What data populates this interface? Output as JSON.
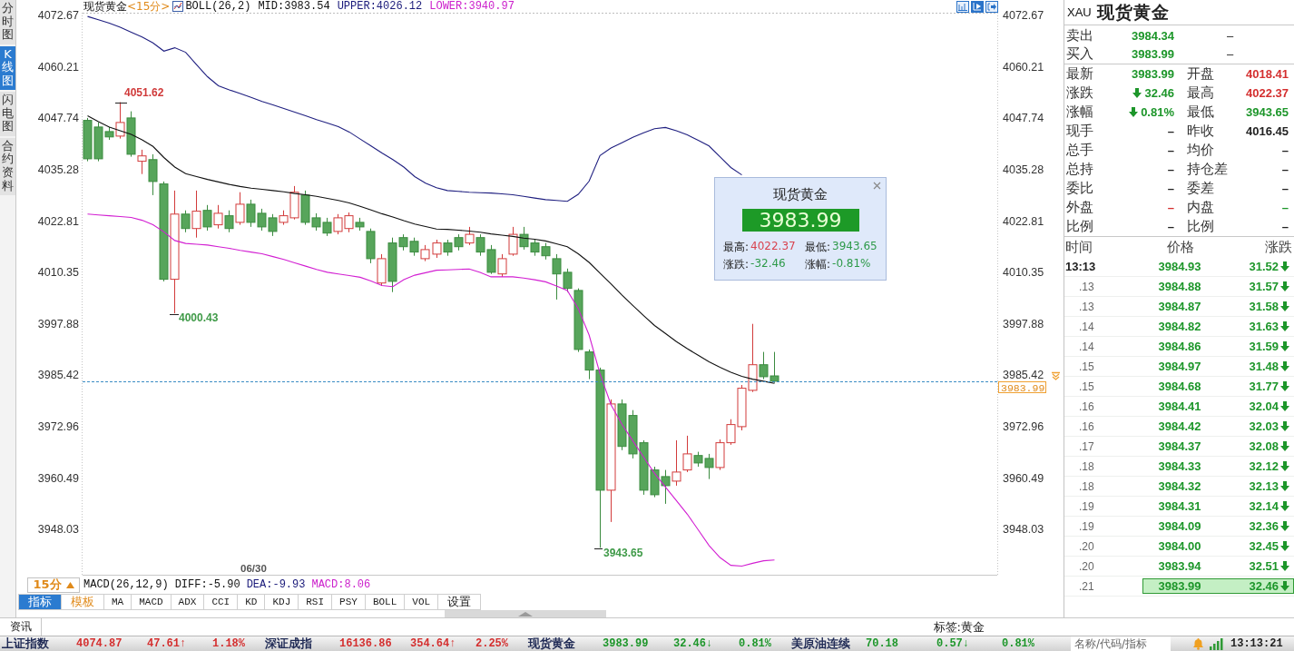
{
  "side_tabs": [
    {
      "label": "分时图",
      "selected": false
    },
    {
      "label": "K线图",
      "selected": true
    },
    {
      "label": "闪电图",
      "selected": false
    },
    {
      "label": "合约资料",
      "selected": false
    }
  ],
  "chart": {
    "symbol": "现货黄金",
    "period": "<15分>",
    "indicator": "BOLL(26,2)",
    "readouts": [
      {
        "kind": "mid",
        "text": "MID:3983.54"
      },
      {
        "kind": "upper",
        "text": "UPPER:4026.12"
      },
      {
        "kind": "lower",
        "text": "LOWER:3940.97"
      }
    ],
    "chart_data": {
      "type": "candlestick",
      "categories": [
        null,
        null,
        null,
        null,
        null,
        null,
        null,
        null,
        null,
        null,
        null,
        null,
        null,
        null,
        null,
        null,
        null,
        null,
        null,
        null,
        null,
        null,
        null,
        null,
        null,
        null,
        null,
        null,
        null,
        null,
        null,
        null,
        null,
        null,
        null,
        null,
        null,
        null,
        null,
        null,
        null,
        null,
        null,
        null,
        null,
        null,
        null,
        null,
        null,
        null,
        null,
        null,
        null,
        null,
        null,
        null,
        null,
        null,
        null,
        null,
        null,
        null,
        null,
        null
      ],
      "ylim": [
        3936.9,
        4073.3
      ],
      "yticks": [
        {
          "value": 4072.67,
          "label": "4072.67"
        },
        {
          "value": 4060.21,
          "label": "4060.21"
        },
        {
          "value": 4047.74,
          "label": "4047.74"
        },
        {
          "value": 4035.28,
          "label": "4035.28"
        },
        {
          "value": 4022.81,
          "label": "4022.81"
        },
        {
          "value": 4010.35,
          "label": "4010.35"
        },
        {
          "value": 3997.88,
          "label": "3997.88"
        },
        {
          "value": 3985.42,
          "label": "3985.42"
        },
        {
          "value": 3972.96,
          "label": "3972.96"
        },
        {
          "value": 3960.49,
          "label": "3960.49"
        },
        {
          "value": 3948.03,
          "label": "3948.03"
        }
      ],
      "ohlc": [
        [
          4047.2,
          4047.8,
          4037.3,
          4037.9
        ],
        [
          4045.6,
          4046.7,
          4037.3,
          4037.9
        ],
        [
          4044.5,
          4045.6,
          4042.5,
          4043.2
        ],
        [
          4043.4,
          4051.62,
          4042.8,
          4046.7
        ],
        [
          4047.8,
          4049.4,
          4038.4,
          4039.0
        ],
        [
          4037.3,
          4040.1,
          4034.2,
          4038.6
        ],
        [
          4037.7,
          4039.0,
          4029.1,
          4032.4
        ],
        [
          4031.8,
          4032.4,
          4008.2,
          4008.7
        ],
        [
          4008.7,
          4030.2,
          4000.43,
          4024.5
        ],
        [
          4024.5,
          4025.4,
          4020.1,
          4021.0
        ],
        [
          4021.0,
          4030.2,
          4018.8,
          4025.2
        ],
        [
          4025.4,
          4026.7,
          4020.5,
          4021.4
        ],
        [
          4021.9,
          4026.7,
          4021.0,
          4024.7
        ],
        [
          4024.1,
          4025.4,
          4020.1,
          4021.0
        ],
        [
          4022.5,
          4029.8,
          4021.9,
          4026.9
        ],
        [
          4026.9,
          4028.0,
          4021.4,
          4022.5
        ],
        [
          4024.7,
          4025.8,
          4020.5,
          4021.4
        ],
        [
          4023.6,
          4024.5,
          4019.2,
          4020.3
        ],
        [
          4022.5,
          4025.4,
          4021.9,
          4024.1
        ],
        [
          4023.6,
          4031.3,
          4023.2,
          4029.8
        ],
        [
          4029.1,
          4030.2,
          4021.9,
          4022.5
        ],
        [
          4023.6,
          4024.7,
          4020.5,
          4021.4
        ],
        [
          4022.5,
          4023.6,
          4019.2,
          4019.9
        ],
        [
          4020.3,
          4024.5,
          4019.6,
          4023.6
        ],
        [
          4021.0,
          4024.9,
          4020.1,
          4024.1
        ],
        [
          4022.5,
          4023.6,
          4020.5,
          4021.4
        ],
        [
          4020.3,
          4021.0,
          4012.6,
          4013.7
        ],
        [
          4007.8,
          4014.8,
          4007.1,
          4013.7
        ],
        [
          4017.5,
          4018.8,
          4005.6,
          4008.2
        ],
        [
          4018.8,
          4019.6,
          4015.7,
          4016.6
        ],
        [
          4017.9,
          4018.8,
          4014.4,
          4015.3
        ],
        [
          4013.7,
          4017.0,
          4013.1,
          4015.9
        ],
        [
          4014.8,
          4018.3,
          4013.9,
          4017.5
        ],
        [
          4017.5,
          4018.3,
          4014.4,
          4015.3
        ],
        [
          4018.8,
          4019.6,
          4015.7,
          4016.6
        ],
        [
          4017.5,
          4021.4,
          4017.0,
          4019.6
        ],
        [
          4018.8,
          4019.6,
          4014.4,
          4015.3
        ],
        [
          4015.9,
          4017.0,
          4010.0,
          4010.4
        ],
        [
          4010.0,
          4014.8,
          4009.3,
          4013.7
        ],
        [
          4014.8,
          4021.4,
          4014.4,
          4019.6
        ],
        [
          4019.6,
          4021.4,
          4015.9,
          4016.6
        ],
        [
          4017.5,
          4018.3,
          4014.4,
          4015.3
        ],
        [
          4016.6,
          4017.5,
          4013.5,
          4014.4
        ],
        [
          4013.7,
          4014.8,
          4003.8,
          4010.0
        ],
        [
          4010.4,
          4011.3,
          4005.6,
          4006.5
        ],
        [
          4006.0,
          4006.5,
          3991.1,
          3991.7
        ],
        [
          3991.1,
          3991.7,
          3984.5,
          3986.7
        ],
        [
          3986.7,
          3987.3,
          3943.65,
          3957.6
        ],
        [
          3957.6,
          3979.6,
          3949.9,
          3978.5
        ],
        [
          3978.5,
          3979.6,
          3967.3,
          3968.2
        ],
        [
          3975.7,
          3977.0,
          3965.3,
          3966.4
        ],
        [
          3969.1,
          3969.7,
          3956.5,
          3957.6
        ],
        [
          3962.5,
          3963.3,
          3955.9,
          3956.5
        ],
        [
          3960.9,
          3962.5,
          3954.3,
          3958.7
        ],
        [
          3959.8,
          3969.7,
          3958.7,
          3962.0
        ],
        [
          3962.5,
          3970.8,
          3962.0,
          3966.4
        ],
        [
          3966.0,
          3966.9,
          3963.3,
          3964.2
        ],
        [
          3965.3,
          3966.4,
          3960.3,
          3963.1
        ],
        [
          3963.1,
          3969.9,
          3962.5,
          3969.1
        ],
        [
          3969.1,
          3974.8,
          3968.6,
          3973.5
        ],
        [
          3973.0,
          3983.1,
          3972.1,
          3982.3
        ],
        [
          3981.8,
          3997.9,
          3981.4,
          3988.0
        ],
        [
          3988.0,
          3991.1,
          3984.5,
          3985.1
        ],
        [
          3985.3,
          3991.1,
          3983.6,
          3984.0
        ]
      ]
    },
    "boll_lines": {
      "chart_data": {
        "type": "line",
        "categories": [
          null,
          null,
          null,
          null,
          null,
          null,
          null,
          null,
          null,
          null,
          null,
          null,
          null,
          null,
          null,
          null,
          null,
          null,
          null,
          null,
          null,
          null,
          null,
          null,
          null,
          null,
          null,
          null,
          null,
          null,
          null,
          null,
          null,
          null,
          null,
          null,
          null,
          null,
          null,
          null,
          null,
          null,
          null,
          null,
          null,
          null,
          null,
          null,
          null,
          null,
          null,
          null,
          null,
          null,
          null,
          null,
          null,
          null,
          null,
          null,
          null,
          null,
          null,
          null
        ],
        "ylim": [
          3936.9,
          4073.3
        ],
        "yticks": [
          {
            "value": 4072.67,
            "label": "4072.67"
          },
          {
            "value": 4060.21,
            "label": "4060.21"
          },
          {
            "value": 4047.74,
            "label": "4047.74"
          },
          {
            "value": 4035.28,
            "label": "4035.28"
          },
          {
            "value": 4022.81,
            "label": "4022.81"
          },
          {
            "value": 4010.35,
            "label": "4010.35"
          },
          {
            "value": 3997.88,
            "label": "3997.88"
          },
          {
            "value": 3985.42,
            "label": "3985.42"
          },
          {
            "value": 3972.96,
            "label": "3972.96"
          },
          {
            "value": 3960.49,
            "label": "3960.49"
          },
          {
            "value": 3948.03,
            "label": "3948.03"
          }
        ],
        "series": [
          {
            "color": "#1f1f80",
            "values": [
              4072.4,
              4071.6,
              4070.8,
              4069.8,
              4068.6,
              4067.4,
              4066.0,
              4064.0,
              4064.8,
              4063.7,
              4060.7,
              4057.8,
              4055.6,
              4054.6,
              4053.7,
              4052.8,
              4051.8,
              4051.0,
              4050.1,
              4049.2,
              4048.3,
              4047.4,
              4046.6,
              4045.7,
              4044.4,
              4042.7,
              4041.0,
              4039.3,
              4037.7,
              4035.9,
              4033.6,
              4032.0,
              4030.9,
              4030.2,
              4030.0,
              4029.8,
              4029.7,
              4029.6,
              4029.4,
              4029.2,
              4028.8,
              4028.4,
              4028.0,
              4027.8,
              4027.6,
              4029.3,
              4032.5,
              4038.7,
              4040.5,
              4041.8,
              4043.1,
              4044.2,
              4045.2,
              4045.5,
              4044.7,
              4043.7,
              4042.4,
              4041.0,
              4038.4,
              4035.8,
              4034.0,
              null,
              null,
              null
            ]
          },
          {
            "color": "#111111",
            "values": [
              4048.3,
              4046.9,
              4045.6,
              4044.7,
              4043.8,
              4042.5,
              4040.9,
              4038.2,
              4035.9,
              4034.3,
              4033.6,
              4032.9,
              4032.3,
              4031.7,
              4031.2,
              4030.8,
              4030.5,
              4030.2,
              4029.9,
              4029.5,
              4029.2,
              4028.8,
              4028.3,
              4027.8,
              4027.2,
              4026.4,
              4025.5,
              4024.6,
              4023.8,
              4022.9,
              4022.1,
              4021.5,
              4020.9,
              4020.8,
              4020.6,
              4020.4,
              4020.1,
              4019.7,
              4019.4,
              4019.1,
              4018.7,
              4018.4,
              4018.0,
              4017.3,
              4016.6,
              4014.9,
              4012.8,
              4010.2,
              4007.6,
              4004.9,
              4002.4,
              3999.9,
              3997.5,
              3995.6,
              3993.6,
              3991.9,
              3990.3,
              3988.7,
              3987.4,
              3986.2,
              3985.2,
              3984.5,
              3984.0,
              3983.5
            ]
          },
          {
            "color": "#d21fd2",
            "values": [
              4024.5,
              4024.3,
              4024.1,
              4023.9,
              4023.7,
              4023.0,
              4021.9,
              4020.2,
              4018.1,
              4017.4,
              4017.2,
              4017.0,
              4016.6,
              4016.2,
              4015.7,
              4015.3,
              4014.9,
              4014.2,
              4013.5,
              4012.7,
              4011.9,
              4011.1,
              4010.4,
              4010.0,
              4009.6,
              4009.2,
              4008.3,
              4007.2,
              4006.9,
              4008.6,
              4009.7,
              4010.3,
              4010.9,
              4011.0,
              4011.1,
              4011.2,
              4010.4,
              4009.3,
              4009.3,
              4009.3,
              4009.0,
              4008.6,
              4008.1,
              4007.1,
              4006.0,
              4001.6,
              3995.2,
              3985.8,
              3978.3,
              3973.6,
              3969.6,
              3965.6,
              3961.7,
              3958.4,
              3955.1,
              3951.8,
              3948.0,
              3944.2,
              3941.3,
              3939.4,
              3939.2,
              3939.9,
              3940.5,
              3940.7
            ]
          }
        ],
        "ref_lines": [
          {
            "axis": "y",
            "value": 3983.99,
            "label": "3983.99"
          }
        ]
      }
    },
    "annotations": [
      {
        "kind": "high",
        "text": "4051.62"
      },
      {
        "kind": "low",
        "text": "4000.43"
      },
      {
        "kind": "low",
        "text": "3943.65"
      }
    ],
    "date_label": "06/30"
  },
  "popup": {
    "title": "现货黄金",
    "price": "3983.99",
    "falling": true,
    "stats": [
      {
        "label": "最高:",
        "value": "4022.37",
        "color": "#d8434f"
      },
      {
        "label": "最低:",
        "value": "3943.65",
        "color": "#2e9a4a"
      },
      {
        "label": "涨跌:",
        "value": "-32.46",
        "color": "#2e9a4a"
      },
      {
        "label": "涨幅:",
        "value": "-0.81%",
        "color": "#2e9a4a"
      }
    ]
  },
  "period_button": {
    "label": "15分"
  },
  "macd": {
    "title": "MACD(26,12,9)",
    "lines": [
      {
        "kind": "diff",
        "text": "DIFF:-5.90"
      },
      {
        "kind": "dea",
        "text": "DEA:-9.93"
      },
      {
        "kind": "macd",
        "text": "MACD:8.06"
      }
    ]
  },
  "indicator_tabs": [
    {
      "label": "指标",
      "kind": "menu",
      "selected": true
    },
    {
      "label": "模板",
      "kind": "menu",
      "selected": false
    },
    {
      "label": "MA",
      "kind": "indicator",
      "selected": false
    },
    {
      "label": "MACD",
      "kind": "indicator",
      "selected": false
    },
    {
      "label": "ADX",
      "kind": "indicator",
      "selected": false
    },
    {
      "label": "CCI",
      "kind": "indicator",
      "selected": false
    },
    {
      "label": "KD",
      "kind": "indicator",
      "selected": false
    },
    {
      "label": "KDJ",
      "kind": "indicator",
      "selected": false
    },
    {
      "label": "RSI",
      "kind": "indicator",
      "selected": false
    },
    {
      "label": "PSY",
      "kind": "indicator",
      "selected": false
    },
    {
      "label": "BOLL",
      "kind": "indicator",
      "selected": false
    },
    {
      "label": "VOL",
      "kind": "indicator",
      "selected": false
    },
    {
      "label": "设置",
      "kind": "indicator",
      "selected": false
    }
  ],
  "quote": {
    "code": "XAU",
    "name": "现货黄金",
    "book": [
      {
        "label": "卖出",
        "price": "3984.34",
        "falling": true,
        "volume": "–"
      },
      {
        "label": "买入",
        "price": "3983.99",
        "falling": true,
        "volume": "–"
      }
    ],
    "stats": [
      {
        "label": "最新",
        "value": "3983.99",
        "color": "#1d962a",
        "arrow": false
      },
      {
        "label": "开盘",
        "value": "4018.41",
        "color": "#d42f2f",
        "arrow": false
      },
      {
        "label": "涨跌",
        "value": "32.46",
        "color": "#1d962a",
        "arrow": true
      },
      {
        "label": "最高",
        "value": "4022.37",
        "color": "#d42f2f",
        "arrow": false
      },
      {
        "label": "涨幅",
        "value": "0.81%",
        "color": "#1d962a",
        "arrow": true
      },
      {
        "label": "最低",
        "value": "3943.65",
        "color": "#1d962a",
        "arrow": false
      },
      {
        "label": "现手",
        "value": "–",
        "color": "#222222",
        "arrow": false
      },
      {
        "label": "昨收",
        "value": "4016.45",
        "color": "#222222",
        "arrow": false
      },
      {
        "label": "总手",
        "value": "–",
        "color": "#222222",
        "arrow": false
      },
      {
        "label": "均价",
        "value": "–",
        "color": "#222222",
        "arrow": false
      },
      {
        "label": "总持",
        "value": "–",
        "color": "#222222",
        "arrow": false
      },
      {
        "label": "持仓差",
        "value": "–",
        "color": "#222222",
        "arrow": false
      },
      {
        "label": "委比",
        "value": "–",
        "color": "#222222",
        "arrow": false
      },
      {
        "label": "委差",
        "value": "–",
        "color": "#222222",
        "arrow": false
      },
      {
        "label": "外盘",
        "value": "–",
        "color": "#d42f2f",
        "arrow": false
      },
      {
        "label": "内盘",
        "value": "–",
        "color": "#1d962a",
        "arrow": false
      },
      {
        "label": "比例",
        "value": "–",
        "color": "#222222",
        "arrow": false
      },
      {
        "label": "比例",
        "value": "–",
        "color": "#222222",
        "arrow": false
      }
    ]
  },
  "ticks": {
    "columns": [
      "时间",
      "价格",
      "涨跌"
    ],
    "rows": [
      {
        "kind": "full",
        "time": "13:13",
        "price": "3984.93",
        "change": "31.52",
        "falling": true,
        "selected": false
      },
      {
        "kind": "short",
        "time": ".13",
        "price": "3984.88",
        "change": "31.57",
        "falling": true,
        "selected": false
      },
      {
        "kind": "short",
        "time": ".13",
        "price": "3984.87",
        "change": "31.58",
        "falling": true,
        "selected": false
      },
      {
        "kind": "short",
        "time": ".14",
        "price": "3984.82",
        "change": "31.63",
        "falling": true,
        "selected": false
      },
      {
        "kind": "short",
        "time": ".14",
        "price": "3984.86",
        "change": "31.59",
        "falling": true,
        "selected": false
      },
      {
        "kind": "short",
        "time": ".15",
        "price": "3984.97",
        "change": "31.48",
        "falling": true,
        "selected": false
      },
      {
        "kind": "short",
        "time": ".15",
        "price": "3984.68",
        "change": "31.77",
        "falling": true,
        "selected": false
      },
      {
        "kind": "short",
        "time": ".16",
        "price": "3984.41",
        "change": "32.04",
        "falling": true,
        "selected": false
      },
      {
        "kind": "short",
        "time": ".16",
        "price": "3984.42",
        "change": "32.03",
        "falling": true,
        "selected": false
      },
      {
        "kind": "short",
        "time": ".17",
        "price": "3984.37",
        "change": "32.08",
        "falling": true,
        "selected": false
      },
      {
        "kind": "short",
        "time": ".18",
        "price": "3984.33",
        "change": "32.12",
        "falling": true,
        "selected": false
      },
      {
        "kind": "short",
        "time": ".18",
        "price": "3984.32",
        "change": "32.13",
        "falling": true,
        "selected": false
      },
      {
        "kind": "short",
        "time": ".19",
        "price": "3984.31",
        "change": "32.14",
        "falling": true,
        "selected": false
      },
      {
        "kind": "short",
        "time": ".19",
        "price": "3984.09",
        "change": "32.36",
        "falling": true,
        "selected": false
      },
      {
        "kind": "short",
        "time": ".20",
        "price": "3984.00",
        "change": "32.45",
        "falling": true,
        "selected": false
      },
      {
        "kind": "short",
        "time": ".20",
        "price": "3983.94",
        "change": "32.51",
        "falling": true,
        "selected": false
      },
      {
        "kind": "short",
        "time": ".21",
        "price": "3983.99",
        "change": "32.46",
        "falling": true,
        "selected": true
      }
    ]
  },
  "news": {
    "tab": "资讯",
    "tag": "标签:黄金"
  },
  "status_bar": {
    "quotes": [
      {
        "name": "上证指数",
        "value": "4074.87",
        "change": "47.61↑",
        "percent": "1.18%",
        "color": "#d42f2f"
      },
      {
        "name": "深证成指",
        "value": "16136.86",
        "change": "354.64↑",
        "percent": "2.25%",
        "color": "#d42f2f"
      },
      {
        "name": "现货黄金",
        "value": "3983.99",
        "change": "32.46↓",
        "percent": "0.81%",
        "color": "#1d962a"
      },
      {
        "name": "美原油连续",
        "value": "70.18",
        "change": "0.57↓",
        "percent": "0.81%",
        "color": "#1d962a"
      }
    ],
    "search": {
      "placeholder": "名称/代码/指标"
    },
    "time": "13:13:21"
  }
}
